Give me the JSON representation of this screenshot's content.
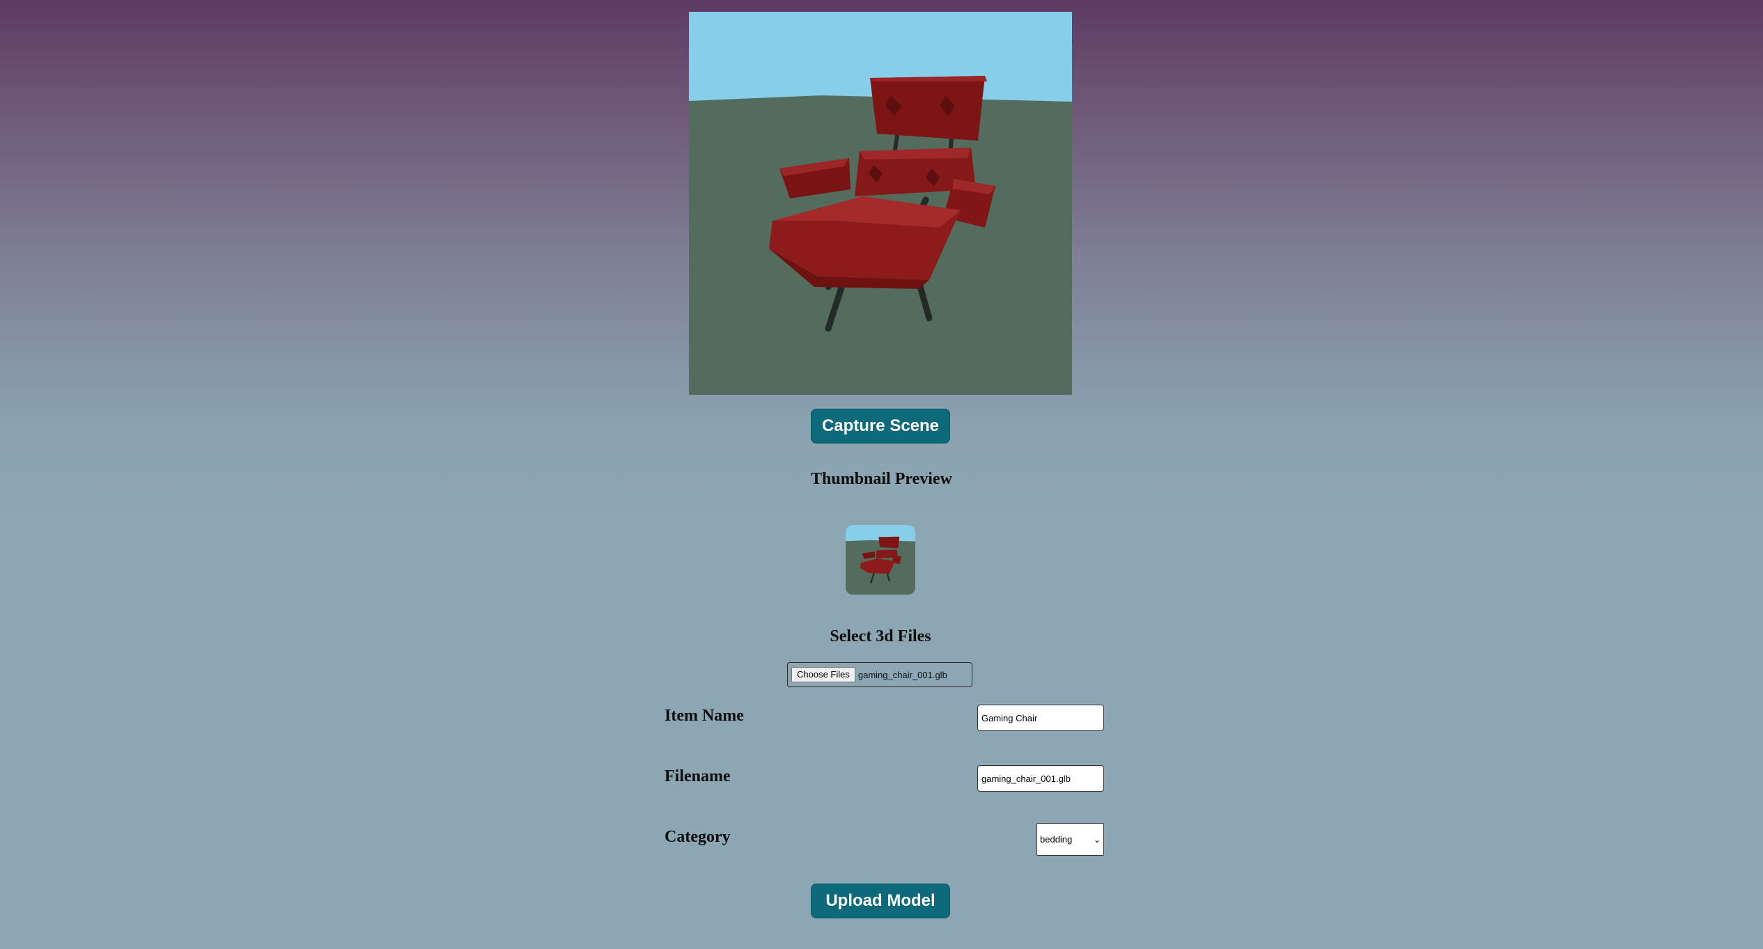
{
  "scene": {
    "viewport_label": "3d-model-viewport",
    "capture_label": "Capture Scene",
    "colors": {
      "sky": "#87ceeb",
      "ground": "#546c5e",
      "chair": "#8b1a1a",
      "button": "#0c6a7b"
    }
  },
  "thumbnail": {
    "heading": "Thumbnail Preview"
  },
  "files": {
    "heading": "Select 3d Files",
    "choose_label": "Choose Files",
    "chosen_name": "gaming_chair_001.glb"
  },
  "form": {
    "item_name_label": "Item Name",
    "item_name_value": "Gaming Chair",
    "filename_label": "Filename",
    "filename_value": "gaming_chair_001.glb",
    "category_label": "Category",
    "category_value": "bedding"
  },
  "actions": {
    "upload_label": "Upload Model"
  }
}
